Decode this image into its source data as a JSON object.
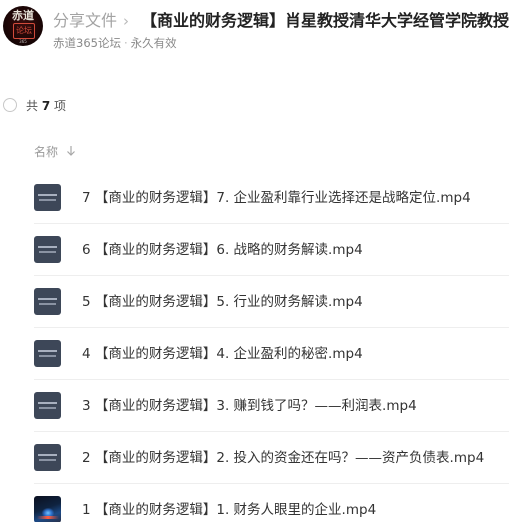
{
  "header": {
    "avatar_icon": "forum-logo-icon",
    "breadcrumb": "分享文件",
    "separator": "›",
    "title": "【商业的财务逻辑】肖星教授清华大学经管学院教授",
    "owner": "赤道365论坛",
    "dot": "·",
    "validity": "永久有效"
  },
  "list_header": {
    "count_prefix": "共",
    "count": "7",
    "count_suffix": "项",
    "column_name": "名称",
    "sort_icon": "arrow-down-icon"
  },
  "files": [
    {
      "name": "7 【商业的财务逻辑】7. 企业盈利靠行业选择还是战略定位.mp4",
      "thumb": "video-thumb-icon"
    },
    {
      "name": "6 【商业的财务逻辑】6. 战略的财务解读.mp4",
      "thumb": "video-thumb-icon"
    },
    {
      "name": "5 【商业的财务逻辑】5. 行业的财务解读.mp4",
      "thumb": "video-thumb-icon"
    },
    {
      "name": "4 【商业的财务逻辑】4. 企业盈利的秘密.mp4",
      "thumb": "video-thumb-icon"
    },
    {
      "name": "3 【商业的财务逻辑】3. 赚到钱了吗？——利润表.mp4",
      "thumb": "video-thumb-icon"
    },
    {
      "name": "2 【商业的财务逻辑】2. 投入的资金还在吗？——资产负债表.mp4",
      "thumb": "video-thumb-icon"
    },
    {
      "name": "1 【商业的财务逻辑】1. 财务人眼里的企业.mp4",
      "thumb": "video-photo-thumb-icon"
    }
  ],
  "colors": {
    "thumb_bg": "#3d4758",
    "text_primary": "#333333",
    "text_muted": "#8a8a8a",
    "divider": "#eeeeee"
  }
}
